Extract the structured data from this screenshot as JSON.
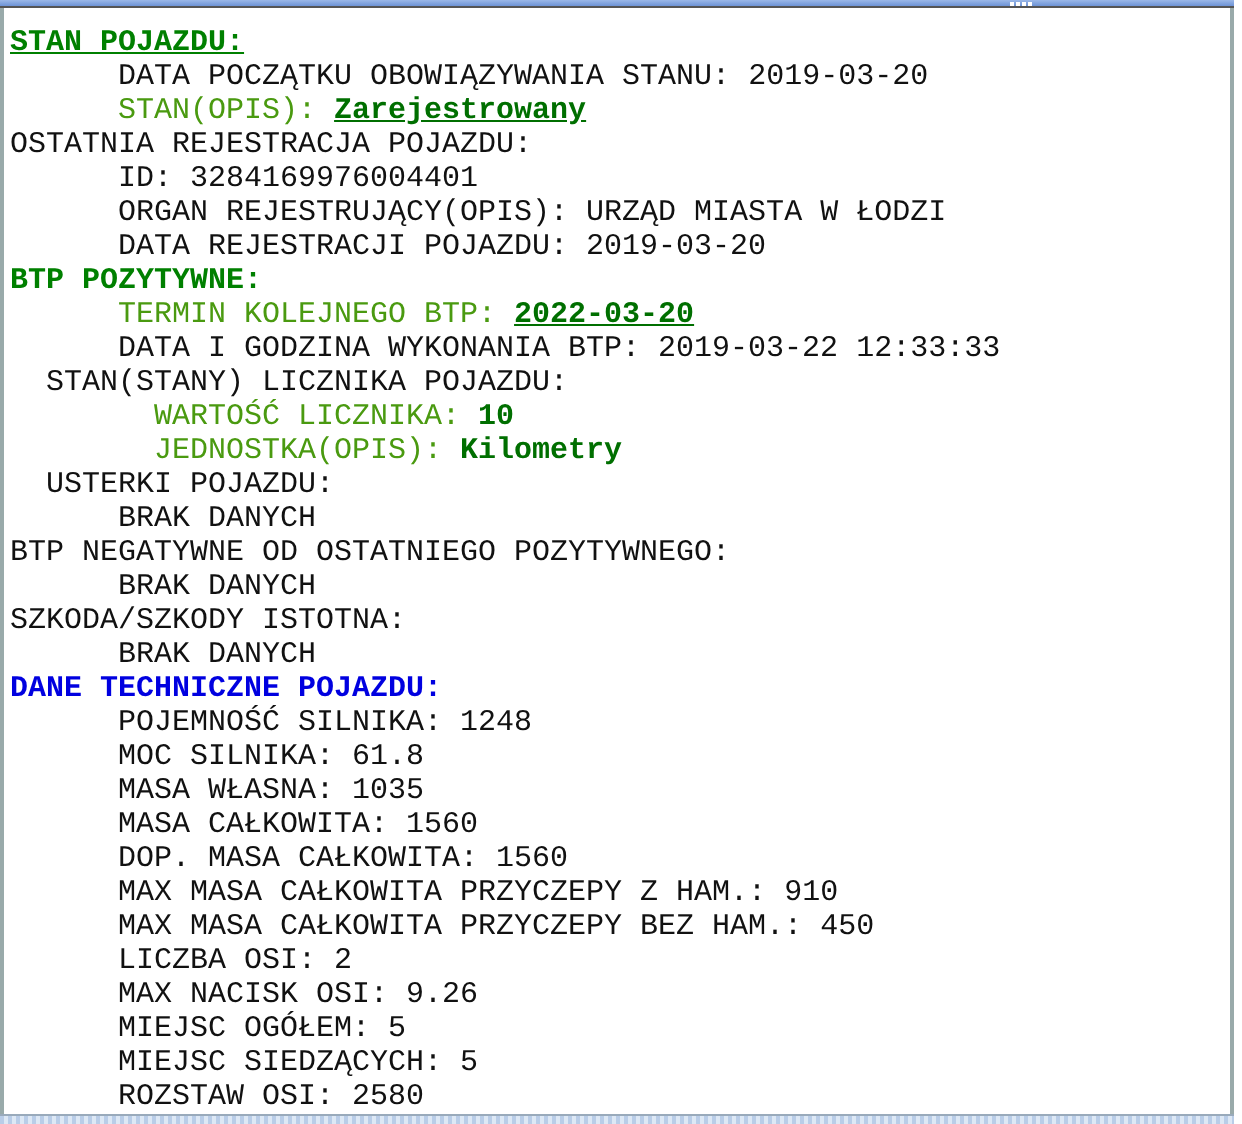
{
  "lines": [
    {
      "kind": "heading",
      "label": "STAN POJAZDU:",
      "color": "#008000",
      "underlined": true
    },
    {
      "kind": "item",
      "label": "DATA POCZĄTKU OBOWIĄZYWANIA STANU:",
      "value": "2019-03-20"
    },
    {
      "kind": "highlight",
      "label": "STAN(OPIS):",
      "value": "Zarejestrowany",
      "underlined": true
    },
    {
      "kind": "group",
      "label": "OSTATNIA REJESTRACJA POJAZDU:"
    },
    {
      "kind": "item",
      "label": "ID:",
      "value": "3284169976004401"
    },
    {
      "kind": "item",
      "label": "ORGAN REJESTRUJĄCY(OPIS):",
      "value": "URZĄD MIASTA W ŁODZI"
    },
    {
      "kind": "item",
      "label": "DATA REJESTRACJI POJAZDU:",
      "value": "2019-03-20"
    },
    {
      "kind": "heading",
      "label": "BTP POZYTYWNE:",
      "color": "#008000",
      "underlined": false
    },
    {
      "kind": "highlight",
      "label": "TERMIN KOLEJNEGO BTP:",
      "value": "2022-03-20",
      "underlined": true
    },
    {
      "kind": "item",
      "label": "DATA I GODZINA WYKONANIA BTP:",
      "value": "2019-03-22 12:33:33"
    },
    {
      "kind": "subgroup",
      "label": "STAN(STANY) LICZNIKA POJAZDU:"
    },
    {
      "kind": "subhighlight",
      "label": "WARTOŚĆ LICZNIKA:",
      "value": "10",
      "underlined": false
    },
    {
      "kind": "subhighlight",
      "label": "JEDNOSTKA(OPIS):",
      "value": "Kilometry",
      "underlined": false
    },
    {
      "kind": "subgroup",
      "label": "USTERKI POJAZDU:"
    },
    {
      "kind": "item",
      "label": "BRAK DANYCH"
    },
    {
      "kind": "group",
      "label": "BTP NEGATYWNE OD OSTATNIEGO POZYTYWNEGO:"
    },
    {
      "kind": "item",
      "label": "BRAK DANYCH"
    },
    {
      "kind": "group",
      "label": "SZKODA/SZKODY ISTOTNA:"
    },
    {
      "kind": "item",
      "label": "BRAK DANYCH"
    },
    {
      "kind": "heading",
      "label": "DANE TECHNICZNE POJAZDU:",
      "color": "#0000e0",
      "underlined": false
    },
    {
      "kind": "item",
      "label": "POJEMNOŚĆ SILNIKA:",
      "value": "1248"
    },
    {
      "kind": "item",
      "label": "MOC SILNIKA:",
      "value": "61.8"
    },
    {
      "kind": "item",
      "label": "MASA WŁASNA:",
      "value": "1035"
    },
    {
      "kind": "item",
      "label": "MASA CAŁKOWITA:",
      "value": "1560"
    },
    {
      "kind": "item",
      "label": "DOP. MASA CAŁKOWITA:",
      "value": "1560"
    },
    {
      "kind": "item",
      "label": "MAX MASA CAŁKOWITA PRZYCZEPY Z HAM.:",
      "value": "910"
    },
    {
      "kind": "item",
      "label": "MAX MASA CAŁKOWITA PRZYCZEPY BEZ HAM.:",
      "value": "450"
    },
    {
      "kind": "item",
      "label": "LICZBA OSI:",
      "value": "2"
    },
    {
      "kind": "item",
      "label": "MAX NACISK OSI:",
      "value": "9.26"
    },
    {
      "kind": "item",
      "label": "MIEJSC OGÓŁEM:",
      "value": "5"
    },
    {
      "kind": "item",
      "label": "MIEJSC SIEDZĄCYCH:",
      "value": "5"
    },
    {
      "kind": "item",
      "label": "ROZSTAW OSI:",
      "value": "2580"
    }
  ]
}
